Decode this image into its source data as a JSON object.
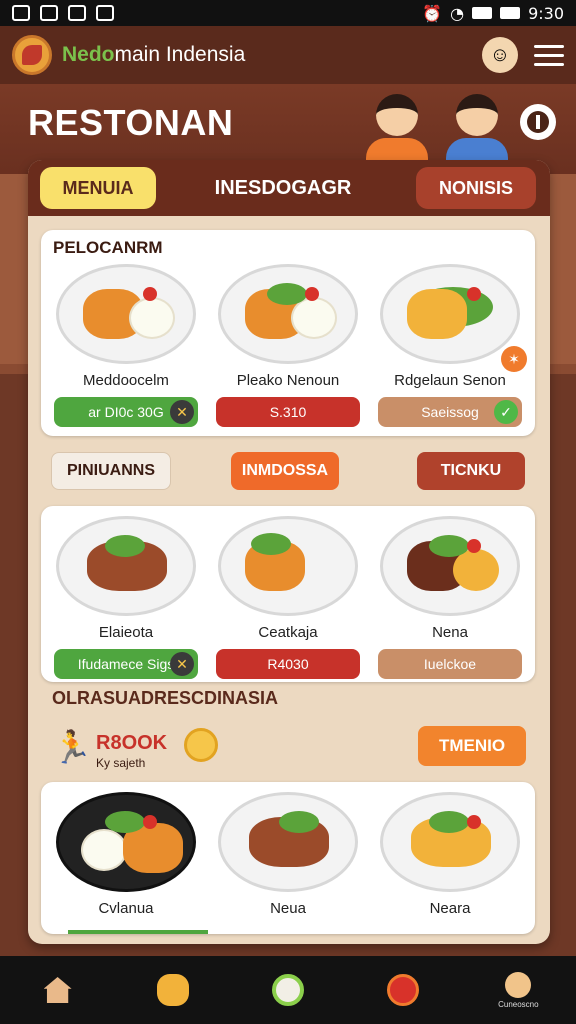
{
  "status": {
    "time": "9:30"
  },
  "app": {
    "brand_prefix": "Nedo",
    "brand_rest": "main Indensia"
  },
  "hero": {
    "title": "RESTONAN"
  },
  "tabs": [
    "MENUIA",
    "INESDOGAGR",
    "NONISIS"
  ],
  "section1": {
    "title": "PELOCANRM",
    "dishes": [
      {
        "name": "Meddoocelm",
        "tag": "ar DI0c 30G",
        "tag_color": "#4fa63f"
      },
      {
        "name": "Pleako Nenoun",
        "tag": "S.310",
        "tag_color": "#c7322a"
      },
      {
        "name": "Rdgelaun Senon",
        "tag": "Saeissog",
        "tag_color": "#c98f68"
      }
    ]
  },
  "chips": [
    "PINIUANNS",
    "INMDOSSA",
    "TICNKU"
  ],
  "section2": {
    "dishes": [
      {
        "name": "Elaieota",
        "tag": "Ifudamece Sigs",
        "tag_color": "#4fa63f"
      },
      {
        "name": "Ceatkaja",
        "tag": "R4030",
        "tag_color": "#c7322a"
      },
      {
        "name": "Nena",
        "tag": "Iuelckoe",
        "tag_color": "#c98f68"
      }
    ]
  },
  "section3": {
    "heading": "OLRASUADRESCDINASIA",
    "promo_big": "R8OOK",
    "promo_small": "Ky sajeth",
    "trend_label": "TMENIO",
    "dishes": [
      {
        "name": "Cvlanua"
      },
      {
        "name": "Neua"
      },
      {
        "name": "Neara"
      }
    ]
  },
  "nav": {
    "profile_label": "Cuneoscno"
  },
  "icons": [
    "home-icon",
    "deal-icon",
    "search-icon",
    "favorite-icon",
    "profile-icon",
    "menu-icon",
    "wifi-icon",
    "battery-icon"
  ],
  "colors": {
    "header": "#5a2a1c",
    "accent_green": "#4fa63f",
    "accent_red": "#c7322a",
    "accent_orange": "#ef6a2a"
  }
}
